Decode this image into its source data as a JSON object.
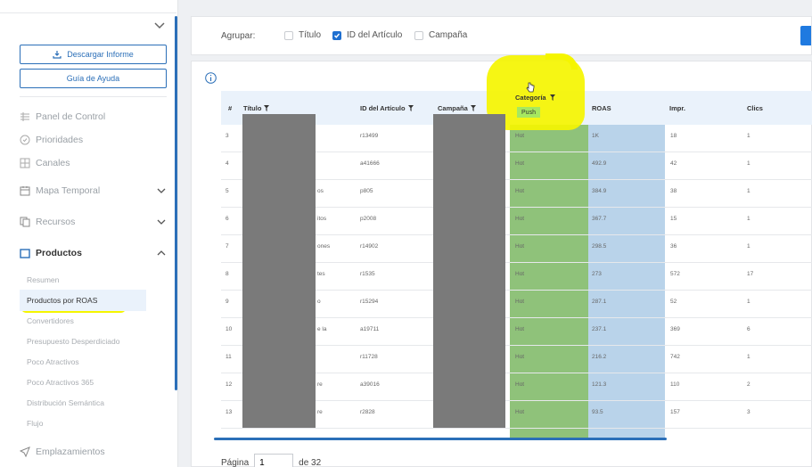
{
  "sidebar": {
    "download_label": "Descargar Informe",
    "help_label": "Guía de Ayuda",
    "nav": [
      {
        "label": "Panel de Control",
        "icon": "dashboard-icon"
      },
      {
        "label": "Prioridades",
        "icon": "priority-icon"
      },
      {
        "label": "Canales",
        "icon": "grid-icon"
      },
      {
        "label": "Mapa Temporal",
        "icon": "calendar-icon"
      },
      {
        "label": "Recursos",
        "icon": "copy-icon"
      },
      {
        "label": "Productos",
        "icon": "folder-icon"
      }
    ],
    "sub": [
      "Resumen",
      "Productos por ROAS",
      "Convertidores",
      "Presupuesto Desperdiciado",
      "Poco Atractivos",
      "Poco Atractivos 365",
      "Distribución Semántica",
      "Flujo"
    ],
    "bottom": {
      "label": "Emplazamientos",
      "icon": "send-icon"
    }
  },
  "grouping": {
    "label": "Agrupar:",
    "options": [
      {
        "label": "Título",
        "checked": false
      },
      {
        "label": "ID del Artículo",
        "checked": true
      },
      {
        "label": "Campaña",
        "checked": false
      }
    ]
  },
  "table": {
    "headers": {
      "num": "#",
      "title": "Título",
      "id": "ID del Artículo",
      "campaign": "Campaña",
      "category": "Categoría",
      "roas": "ROAS",
      "impr": "Impr.",
      "clicks": "Clics"
    },
    "filter_chip": "Push",
    "rows": [
      {
        "n": "3",
        "title_tail": "",
        "id": "r13499",
        "cat": "Hot",
        "roas": "1K",
        "impr": "18",
        "clicks": "1"
      },
      {
        "n": "4",
        "title_tail": "",
        "id": "a41666",
        "cat": "Hot",
        "roas": "492.9",
        "impr": "42",
        "clicks": "1"
      },
      {
        "n": "5",
        "title_tail": "os",
        "id": "p805",
        "cat": "Hot",
        "roas": "384.9",
        "impr": "38",
        "clicks": "1"
      },
      {
        "n": "6",
        "title_tail": "itos",
        "id": "p2008",
        "cat": "Hot",
        "roas": "367.7",
        "impr": "15",
        "clicks": "1"
      },
      {
        "n": "7",
        "title_tail": "ones",
        "id": "r14902",
        "cat": "Hot",
        "roas": "298.5",
        "impr": "36",
        "clicks": "1"
      },
      {
        "n": "8",
        "title_tail": "tes",
        "id": "r1535",
        "cat": "Hot",
        "roas": "273",
        "impr": "572",
        "clicks": "17"
      },
      {
        "n": "9",
        "title_tail": "o",
        "id": "r15294",
        "cat": "Hot",
        "roas": "287.1",
        "impr": "52",
        "clicks": "1"
      },
      {
        "n": "10",
        "title_tail": "e la",
        "id": "a19711",
        "cat": "Hot",
        "roas": "237.1",
        "impr": "369",
        "clicks": "6"
      },
      {
        "n": "11",
        "title_tail": "",
        "id": "r11728",
        "cat": "Hot",
        "roas": "216.2",
        "impr": "742",
        "clicks": "1"
      },
      {
        "n": "12",
        "title_tail": "re",
        "id": "a39016",
        "cat": "Hot",
        "roas": "121.3",
        "impr": "110",
        "clicks": "2"
      },
      {
        "n": "13",
        "title_tail": "re",
        "id": "r2828",
        "cat": "Hot",
        "roas": "93.5",
        "impr": "157",
        "clicks": "3"
      }
    ]
  },
  "pager": {
    "label": "Página",
    "value": "1",
    "of": "de 32"
  },
  "colors": {
    "accent": "#2b6fb8",
    "category_col": "#8fc27a",
    "roas_col": "#b9d3ea",
    "highlight": "#f5f500"
  }
}
